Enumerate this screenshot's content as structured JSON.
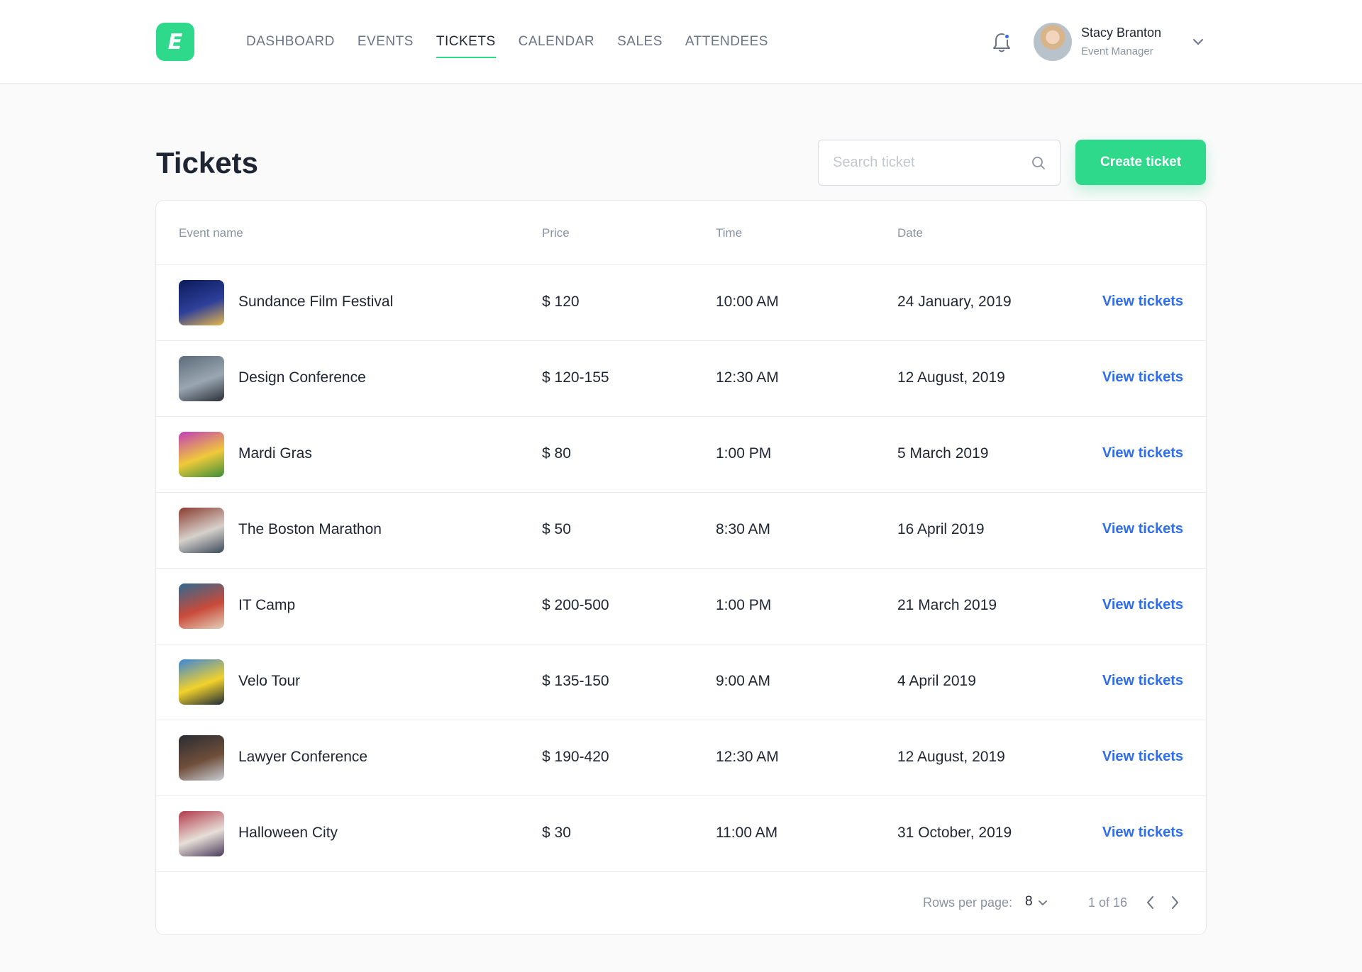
{
  "app": {
    "logo_letter": "E",
    "accent_color": "#2fd98b",
    "link_color": "#2f6df0"
  },
  "nav": {
    "items": [
      {
        "label": "DASHBOARD",
        "active": false
      },
      {
        "label": "EVENTS",
        "active": false
      },
      {
        "label": "TICKETS",
        "active": true
      },
      {
        "label": "CALENDAR",
        "active": false
      },
      {
        "label": "SALES",
        "active": false
      },
      {
        "label": "ATTENDEES",
        "active": false
      }
    ]
  },
  "user": {
    "name": "Stacy Branton",
    "role": "Event Manager",
    "has_notification": true
  },
  "page": {
    "title": "Tickets",
    "search_placeholder": "Search ticket",
    "search_value": "",
    "create_button": "Create ticket"
  },
  "table": {
    "columns": [
      "Event name",
      "Price",
      "Time",
      "Date"
    ],
    "action_label": "View tickets",
    "rows": [
      {
        "name": "Sundance Film Festival",
        "price": "$ 120",
        "time": "10:00 AM",
        "date": "24 January, 2019",
        "thumb_colors": [
          "#0b1a5c",
          "#2d3f99",
          "#e8b84a"
        ]
      },
      {
        "name": "Design Conference",
        "price": "$ 120-155",
        "time": "12:30 AM",
        "date": "12 August, 2019",
        "thumb_colors": [
          "#5c6b78",
          "#9aa7b3",
          "#2b2f36"
        ]
      },
      {
        "name": "Mardi Gras",
        "price": "$ 80",
        "time": "1:00 PM",
        "date": "5 March 2019",
        "thumb_colors": [
          "#c23fb8",
          "#f0c93a",
          "#3a8f3a"
        ]
      },
      {
        "name": "The Boston Marathon",
        "price": "$ 50",
        "time": "8:30 AM",
        "date": "16 April 2019",
        "thumb_colors": [
          "#8a3b2f",
          "#d6d1cb",
          "#3b4a5a"
        ]
      },
      {
        "name": "IT Camp",
        "price": "$ 200-500",
        "time": "1:00 PM",
        "date": "21 March 2019",
        "thumb_colors": [
          "#2e6a8f",
          "#c94a3a",
          "#e3d0b8"
        ]
      },
      {
        "name": "Velo Tour",
        "price": "$ 135-150",
        "time": "9:00 AM",
        "date": "4 April 2019",
        "thumb_colors": [
          "#3b86d9",
          "#f2d22b",
          "#1e2a38"
        ]
      },
      {
        "name": "Lawyer Conference",
        "price": "$ 190-420",
        "time": "12:30 AM",
        "date": "12 August, 2019",
        "thumb_colors": [
          "#2a2c33",
          "#6f4e3a",
          "#c9cfd6"
        ]
      },
      {
        "name": "Halloween City",
        "price": "$ 30",
        "time": "11:00 AM",
        "date": "31 October, 2019",
        "thumb_colors": [
          "#b23a4a",
          "#e6dfd8",
          "#4a3a5a"
        ]
      }
    ]
  },
  "pagination": {
    "rows_per_page_label": "Rows per page:",
    "rows_per_page_value": "8",
    "page_info": "1 of 16"
  }
}
